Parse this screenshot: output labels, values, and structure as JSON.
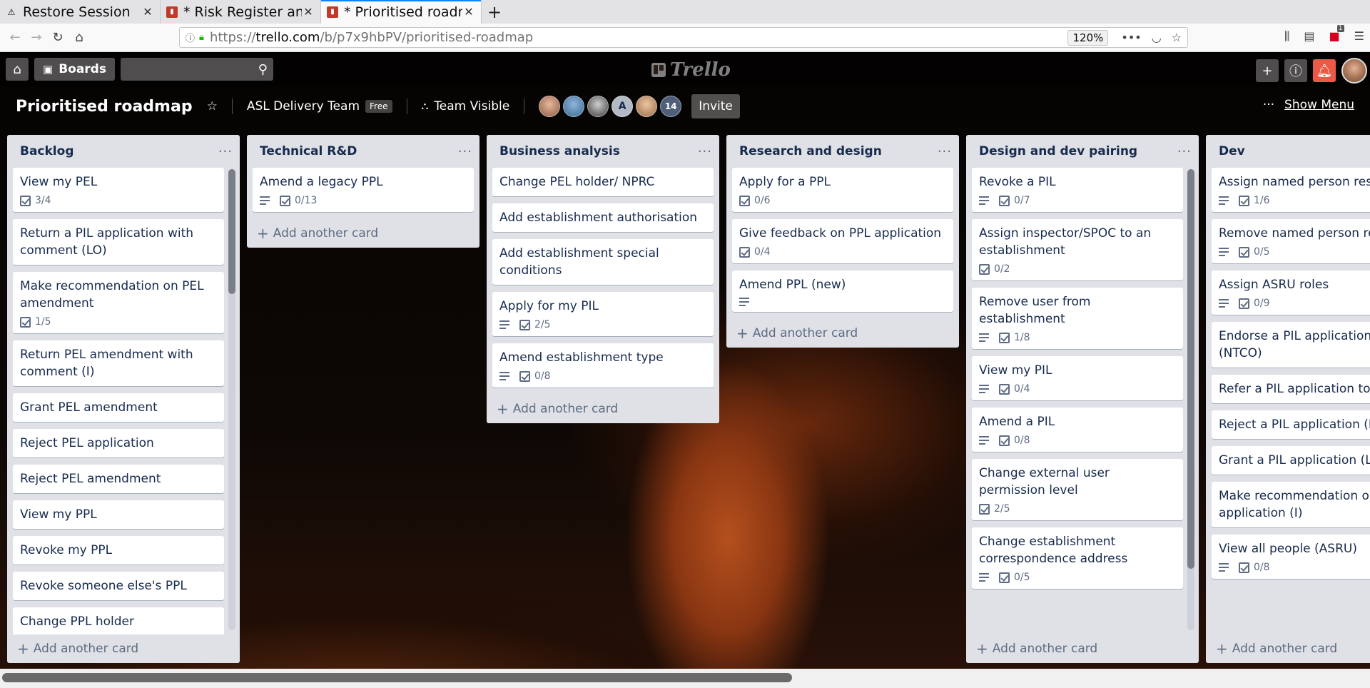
{
  "browser": {
    "tabs": [
      {
        "title": "Restore Session",
        "icon": "warning-icon",
        "active": false
      },
      {
        "title": "* Risk Register and",
        "icon": "trello-favicon",
        "active": false
      },
      {
        "title": "* Prioritised roadmap",
        "icon": "trello-favicon",
        "active": true
      }
    ],
    "url_prefix": "https://",
    "url_host": "trello.com",
    "url_path": "/b/p7x9hbPV/prioritised-roadmap",
    "zoom": "120%",
    "notification_count": "1"
  },
  "header": {
    "boards_label": "Boards",
    "logo_text": "Trello"
  },
  "boardbar": {
    "title": "Prioritised roadmap",
    "team": "ASL Delivery Team",
    "team_badge": "Free",
    "visibility": "Team Visible",
    "member_letter": "A",
    "member_count": "14",
    "invite_label": "Invite",
    "show_menu_label": "Show Menu"
  },
  "lists": [
    {
      "title": "Backlog",
      "add_label": "Add another card",
      "cards": [
        {
          "title": "View my PEL",
          "desc": false,
          "check": "3/4"
        },
        {
          "title": "Return a PIL application with comment (LO)"
        },
        {
          "title": "Make recommendation on PEL amendment",
          "desc": false,
          "check": "1/5"
        },
        {
          "title": "Return PEL amendment with comment (I)"
        },
        {
          "title": "Grant PEL amendment"
        },
        {
          "title": "Reject PEL application"
        },
        {
          "title": "Reject PEL amendment"
        },
        {
          "title": "View my PPL"
        },
        {
          "title": "Revoke my PPL"
        },
        {
          "title": "Revoke someone else's PPL"
        },
        {
          "title": "Change PPL holder"
        }
      ]
    },
    {
      "title": "Technical R&D",
      "add_label": "Add another card",
      "cards": [
        {
          "title": "Amend a legacy PPL",
          "desc": true,
          "check": "0/13"
        }
      ]
    },
    {
      "title": "Business analysis",
      "add_label": "Add another card",
      "cards": [
        {
          "title": "Change PEL holder/ NPRC"
        },
        {
          "title": "Add establishment authorisation"
        },
        {
          "title": "Add establishment special conditions"
        },
        {
          "title": "Apply for my PIL",
          "desc": true,
          "check": "2/5"
        },
        {
          "title": "Amend establishment type",
          "desc": true,
          "check": "0/8"
        }
      ]
    },
    {
      "title": "Research and design",
      "add_label": "Add another card",
      "cards": [
        {
          "title": "Apply for a PPL",
          "desc": false,
          "check": "0/6"
        },
        {
          "title": "Give feedback on PPL application",
          "desc": false,
          "check": "0/4"
        },
        {
          "title": "Amend PPL (new)",
          "desc": true
        }
      ]
    },
    {
      "title": "Design and dev pairing",
      "add_label": "Add another card",
      "cards": [
        {
          "title": "Revoke a PIL",
          "desc": true,
          "check": "0/7"
        },
        {
          "title": "Assign inspector/SPOC to an establishment",
          "desc": false,
          "check": "0/2"
        },
        {
          "title": "Remove user from establishment",
          "desc": true,
          "check": "1/8"
        },
        {
          "title": "View my PIL",
          "desc": true,
          "check": "0/4"
        },
        {
          "title": "Amend a PIL",
          "desc": true,
          "check": "0/8"
        },
        {
          "title": "Change external user permission level",
          "desc": false,
          "check": "2/5"
        },
        {
          "title": "Change establishment correspondence address",
          "desc": true,
          "check": "0/5"
        }
      ]
    },
    {
      "title": "Dev",
      "add_label": "Add another card",
      "cards": [
        {
          "title": "Assign named person respon",
          "desc": true,
          "check": "1/6"
        },
        {
          "title": "Remove named person respo",
          "desc": true,
          "check": "0/5"
        },
        {
          "title": "Assign ASRU roles",
          "desc": true,
          "check": "0/9"
        },
        {
          "title": "Endorse a PIL application/am (NTCO)"
        },
        {
          "title": "Refer a PIL application to an (LO)"
        },
        {
          "title": "Reject a PIL application (LO)"
        },
        {
          "title": "Grant a PIL application (LO)"
        },
        {
          "title": "Make recommendation on re application (I)"
        },
        {
          "title": "View all people (ASRU)",
          "desc": true,
          "check": "0/8"
        }
      ]
    }
  ],
  "colors": {
    "list_bg": "#dfe1e6",
    "card_text": "#172b4d",
    "notification": "#eb5a46"
  }
}
